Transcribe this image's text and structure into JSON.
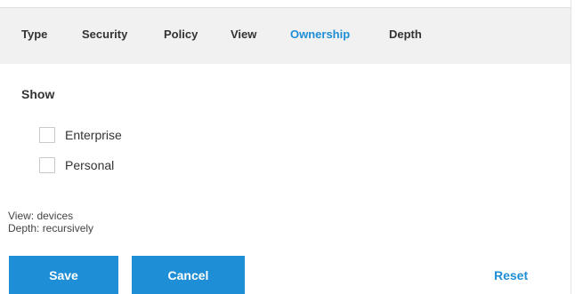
{
  "tabs": [
    {
      "label": "Type"
    },
    {
      "label": "Security"
    },
    {
      "label": "Policy"
    },
    {
      "label": "View"
    },
    {
      "label": "Ownership",
      "active": true
    },
    {
      "label": "Depth"
    }
  ],
  "show": {
    "title": "Show",
    "options": [
      {
        "label": "Enterprise",
        "checked": false
      },
      {
        "label": "Personal",
        "checked": false
      }
    ]
  },
  "summary": {
    "view": "View: devices",
    "depth": "Depth: recursively"
  },
  "buttons": {
    "save": "Save",
    "cancel": "Cancel",
    "reset": "Reset"
  },
  "colors": {
    "accent": "#1e8ed6",
    "tabbar_bg": "#f1f1f1",
    "text": "#333333"
  }
}
